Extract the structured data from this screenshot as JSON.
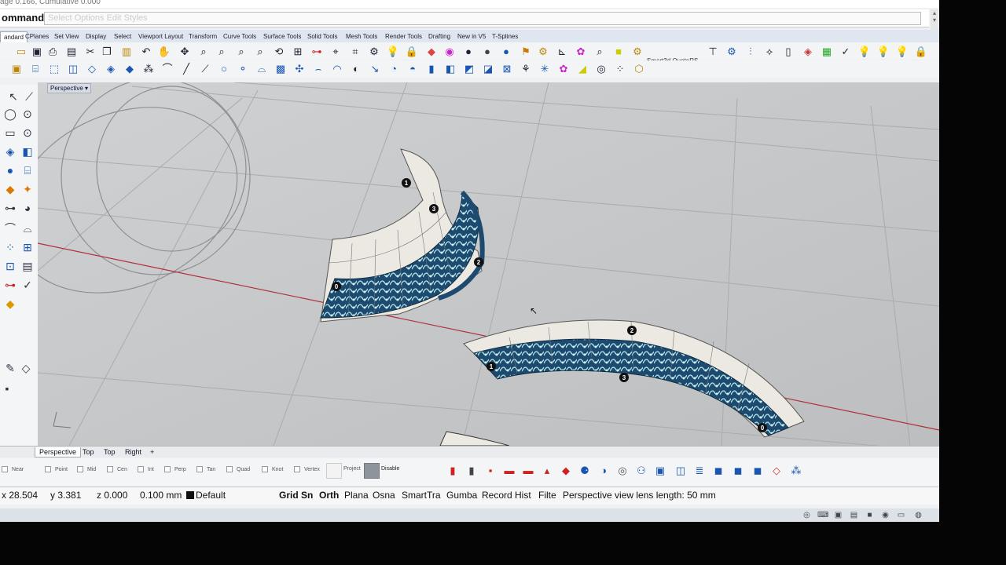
{
  "command": {
    "history_line": "age 0.166, Cumulative 0.000",
    "label": "ommand:",
    "input_value": "",
    "input_placeholder": "Select Options Edit Styles"
  },
  "tabs": [
    "andard",
    "CPlanes",
    "Set View",
    "Display",
    "Select",
    "Viewport Layout",
    "Transform",
    "Curve Tools",
    "Surface Tools",
    "Solid Tools",
    "Mesh Tools",
    "Render Tools",
    "Drafting",
    "New in V5",
    "T-Splines"
  ],
  "toolbar_plugin_label": "Smart3d QuoteRS",
  "viewport": {
    "title": "Perspective",
    "title_arrow": "▾",
    "control_point_labels": [
      "1",
      "3",
      "2",
      "0",
      "1",
      "2",
      "3",
      "0"
    ]
  },
  "view_tabs": [
    "Perspective",
    "Top",
    "Top",
    "Right"
  ],
  "view_tab_add": "+",
  "osnaps": [
    "Near",
    "Point",
    "Mid",
    "Cen",
    "Int",
    "Perp",
    "Tan",
    "Quad",
    "Knot",
    "Vertex"
  ],
  "osnap_project": "Project",
  "osnap_disable": "Disable",
  "status": {
    "x": "x 28.504",
    "y": "y 3.381",
    "z": "z 0.000",
    "distance": "0.100 mm",
    "layer": "Default",
    "panes": [
      "Grid Sn",
      "Orth",
      "Plana",
      "Osna",
      "SmartTra",
      "Gumba",
      "Record Hist",
      "Filte"
    ],
    "message": "Perspective view lens length: 50 mm"
  },
  "colors": {
    "accent_blue": "#2d6fbf",
    "grid_line": "#a9abad",
    "x_axis": "#b0303a",
    "ornament_dark": "#173a5a",
    "ornament_light": "#8fd0d8"
  }
}
